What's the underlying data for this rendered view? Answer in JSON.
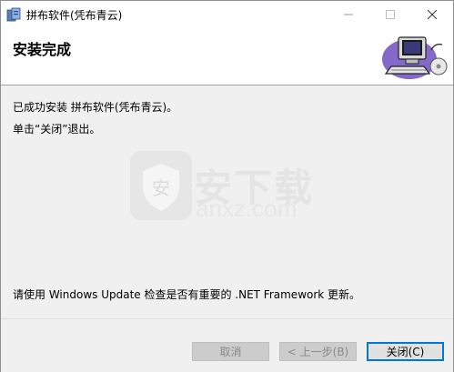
{
  "window": {
    "title": "拼布软件(凭布青云)"
  },
  "header": {
    "title": "安装完成"
  },
  "body": {
    "line1": "已成功安装 拼布软件(凭布青云)。",
    "line2": "单击“关闭”退出。",
    "line3": "请使用 Windows Update 检查是否有重要的 .NET Framework 更新。"
  },
  "watermark": {
    "text": "安下载",
    "sub": "anxz.com",
    "badge": "安"
  },
  "buttons": {
    "cancel": "取消",
    "back": "< 上一步(B)",
    "close": "关闭(C)"
  },
  "colors": {
    "accent": "#0078d7",
    "body_bg": "#f0f0f0",
    "disabled_bg": "#cccccc"
  },
  "icons": [
    "installer-icon",
    "minimize-icon",
    "maximize-icon",
    "close-icon",
    "computer-cd-icon"
  ]
}
